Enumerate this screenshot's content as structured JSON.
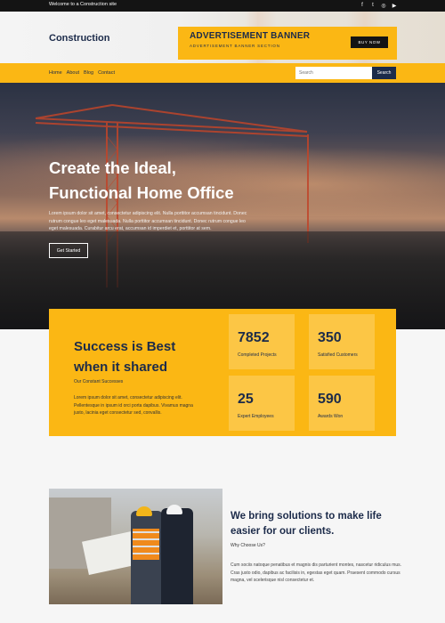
{
  "topbar": {
    "welcome": "Welcome to a Construction site",
    "socials": [
      {
        "icon": "facebook-icon",
        "glyph": "f"
      },
      {
        "icon": "twitter-icon",
        "glyph": "t"
      },
      {
        "icon": "instagram-icon",
        "glyph": "◎"
      },
      {
        "icon": "youtube-icon",
        "glyph": "▶"
      }
    ]
  },
  "header": {
    "brand": "Construction",
    "ad": {
      "title": "ADVERTISEMENT BANNER",
      "subtitle": "ADVERTISEMENT BANNER SECTION",
      "button": "BUY NOW"
    }
  },
  "nav": {
    "items": [
      "Home",
      "About",
      "Blog",
      "Contact"
    ],
    "search_placeholder": "Search",
    "search_button": "Search"
  },
  "hero": {
    "title_line1": "Create the Ideal,",
    "title_line2": "Functional Home Office",
    "description": "Lorem ipsum dolor sit amet, consectetur adipiscing elit. Nulla porttitor accumsan tincidunt. Donec rutrum congue leo eget malesuada. Nulla porttitor accumsan tincidunt. Donec rutrum congue leo eget malesuada. Curabitur arcu erat, accumsan id imperdiet et, porttitor at sem.",
    "cta": "Get Started"
  },
  "stats": {
    "title_line1": "Success is Best",
    "title_line2": "when it shared",
    "subtitle": "Our Constant Successes",
    "description": "Lorem ipsum dolor sit amet, consectetur adipiscing elit. Pellentesque in ipsum id orci porta dapibus. Vivamus magna justo, lacinia eget consectetur sed, convallis.",
    "cards": [
      {
        "value": "7852",
        "label": "Completed Projects"
      },
      {
        "value": "350",
        "label": "Satisfied Customers"
      },
      {
        "value": "25",
        "label": "Expert Employees"
      },
      {
        "value": "590",
        "label": "Awards Won"
      }
    ]
  },
  "about": {
    "title": "We bring solutions to make life easier for our clients.",
    "subtitle": "Why Choose Us?",
    "description": "Cum sociis natoque penatibus et magnis dis parturient montes, nascetur ridiculus mus. Cras justo odio, dapibus ac facilisis in, egestas eget quam. Praesent commodo cursus magna, vel scelerisque nisl consectetur et."
  },
  "colors": {
    "accent": "#fbb714",
    "navy": "#1c2b4a",
    "dark": "#141414"
  }
}
